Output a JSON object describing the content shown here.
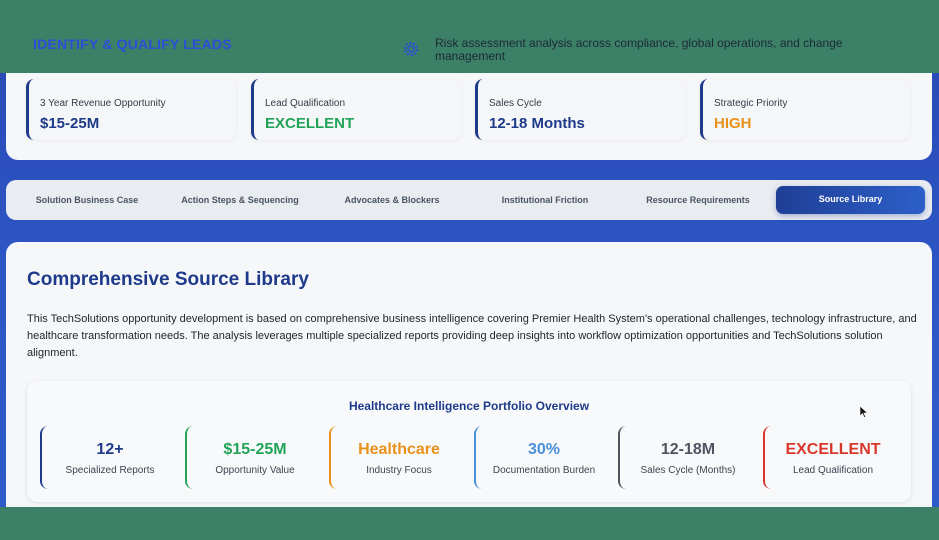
{
  "header": {
    "title": "IDENTIFY & QUALIFY LEADS",
    "risk_icon": "settings-gear-icon",
    "risk_text": "Risk assessment analysis across compliance, global operations, and change management"
  },
  "metrics": [
    {
      "label": "3 Year Revenue Opportunity",
      "value": "$15-25M",
      "color": "#1e3a8a"
    },
    {
      "label": "Lead Qualification",
      "value": "EXCELLENT",
      "color": "#22a35a"
    },
    {
      "label": "Sales Cycle",
      "value": "12-18 Months",
      "color": "#1e3a8a"
    },
    {
      "label": "Strategic Priority",
      "value": "HIGH",
      "color": "#e8921b"
    }
  ],
  "tabs": [
    {
      "label": "Solution Business Case"
    },
    {
      "label": "Action Steps & Sequencing"
    },
    {
      "label": "Advocates & Blockers"
    },
    {
      "label": "Institutional Friction"
    },
    {
      "label": "Resource Requirements"
    },
    {
      "label": "Source Library",
      "active": true
    }
  ],
  "main": {
    "title": "Comprehensive Source Library",
    "description": "This TechSolutions opportunity development is based on comprehensive business intelligence covering Premier Health System's operational challenges, technology infrastructure, and healthcare transformation needs. The analysis leverages multiple specialized reports providing deep insights into workflow optimization opportunities and TechSolutions solution alignment."
  },
  "portfolio": {
    "title": "Healthcare Intelligence Portfolio Overview",
    "stats": [
      {
        "value": "12+",
        "label": "Specialized Reports",
        "color": "#1e3a8a"
      },
      {
        "value": "$15-25M",
        "label": "Opportunity Value",
        "color": "#22a35a"
      },
      {
        "value": "Healthcare",
        "label": "Industry Focus",
        "color": "#e8921b"
      },
      {
        "value": "30%",
        "label": "Documentation Burden",
        "color": "#4a8fd9"
      },
      {
        "value": "12-18M",
        "label": "Sales Cycle (Months)",
        "color": "#4d5660"
      },
      {
        "value": "EXCELLENT",
        "label": "Lead Qualification",
        "color": "#d9372b"
      }
    ]
  },
  "colors": {
    "accent": "#1e3a8a",
    "frame": "#3d8068",
    "background": "#2c56c4"
  }
}
